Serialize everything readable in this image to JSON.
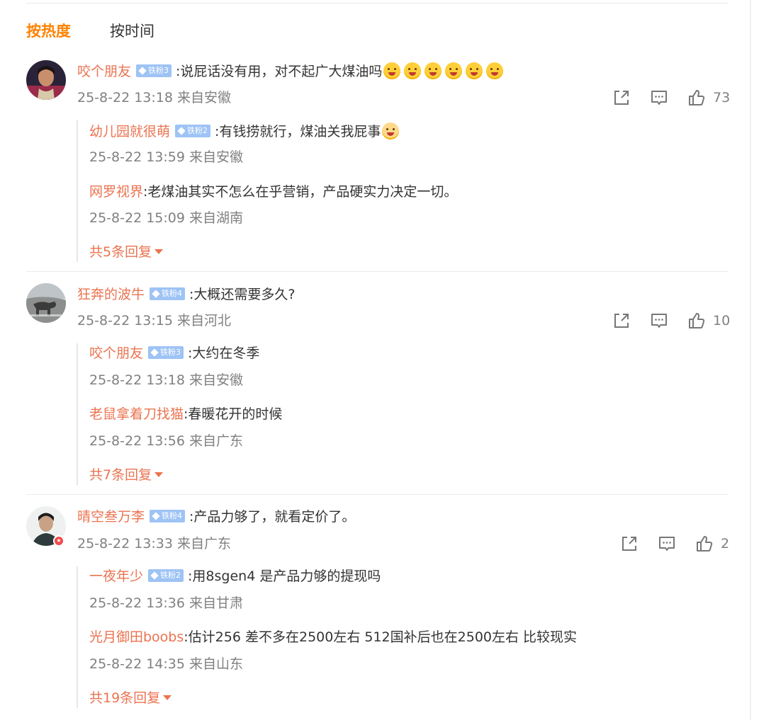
{
  "tabs": {
    "hot": "按热度",
    "time": "按时间"
  },
  "colors": {
    "accent": "#ff8200",
    "username": "#eb7350",
    "meta": "#808080",
    "fan_badge": "#9ec3f5"
  },
  "comments": [
    {
      "user": "咬个朋友",
      "fan_level": "铁粉3",
      "text": ":说屁话没有用，对不起广大煤油吗",
      "emojis": [
        "face-emoji",
        "face-emoji",
        "face-emoji",
        "face-emoji",
        "face-emoji",
        "face-emoji"
      ],
      "meta": "25-8-22 13:18 来自安徽",
      "likes": "73",
      "replies": [
        {
          "user": "幼儿园就很萌",
          "fan_level": "铁粉2",
          "text": ":有钱捞就行，煤油关我屁事",
          "emoji": "dog-emoji",
          "meta": "25-8-22 13:59 来自安徽"
        },
        {
          "user": "网罗视界",
          "text": ":老煤油其实不怎么在乎营销，产品硬实力决定一切。",
          "meta": "25-8-22 15:09 来自湖南"
        }
      ],
      "more": "共5条回复"
    },
    {
      "user": "狂奔的波牛",
      "fan_level": "铁粉4",
      "text": ":大概还需要多久?",
      "meta": "25-8-22 13:15 来自河北",
      "likes": "10",
      "replies": [
        {
          "user": "咬个朋友",
          "fan_level": "铁粉3",
          "text": ":大约在冬季",
          "meta": "25-8-22 13:18 来自安徽"
        },
        {
          "user": "老鼠拿着刀找猫",
          "text": ":春暖花开的时候",
          "meta": "25-8-22 13:56 来自广东"
        }
      ],
      "more": "共7条回复"
    },
    {
      "user": "晴空叁万李",
      "fan_level": "铁粉4",
      "text": ":产品力够了，就看定价了。",
      "meta": "25-8-22 13:33 来自广东",
      "likes": "2",
      "replies": [
        {
          "user": "一夜年少",
          "fan_level": "铁粉2",
          "text": ":用8sgen4 是产品力够的提现吗",
          "meta": "25-8-22 13:36 来自甘肃"
        },
        {
          "user": "光月御田boobs",
          "text": ":估计256 差不多在2500左右 512国补后也在2500左右 比较现实",
          "meta": "25-8-22 14:35 来自山东"
        }
      ],
      "more": "共19条回复"
    }
  ]
}
